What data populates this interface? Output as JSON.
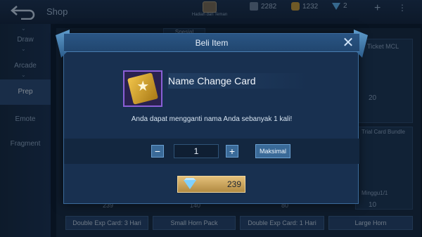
{
  "topbar": {
    "title": "Shop",
    "gift_label": "Hadiah dari Teman",
    "currency": {
      "battle_points": "2282",
      "gold": "1232",
      "diamonds": "2"
    }
  },
  "sidebar": {
    "items": [
      {
        "label": "Draw"
      },
      {
        "label": "Arcade"
      },
      {
        "label": "Prep"
      },
      {
        "label": "Emote"
      },
      {
        "label": "Fragment"
      }
    ]
  },
  "background": {
    "tabs": [
      "Spesial"
    ],
    "right_card_title": "Ticket MCL",
    "right_card_price": "20",
    "right_card2_title": "Trial Card Bundle",
    "right_card2_sub": "Minggu1/1",
    "right_card2_price": "10",
    "bottom_prices": [
      "239",
      "140",
      "80"
    ],
    "bottom_labels": [
      "Double Exp Card: 3 Hari",
      "Small Horn Pack",
      "Double Exp Card: 1 Hari",
      "Large Horn"
    ]
  },
  "dialog": {
    "title": "Beli Item",
    "item_name": "Name Change Card",
    "description": "Anda dapat mengganti nama Anda sebanyak 1 kali!",
    "quantity": "1",
    "max_label": "Maksimal",
    "price": "239"
  },
  "colors": {
    "accent": "#3a6a98",
    "buy_button": "#e4c07a",
    "card_border": "#8a5fd6"
  }
}
